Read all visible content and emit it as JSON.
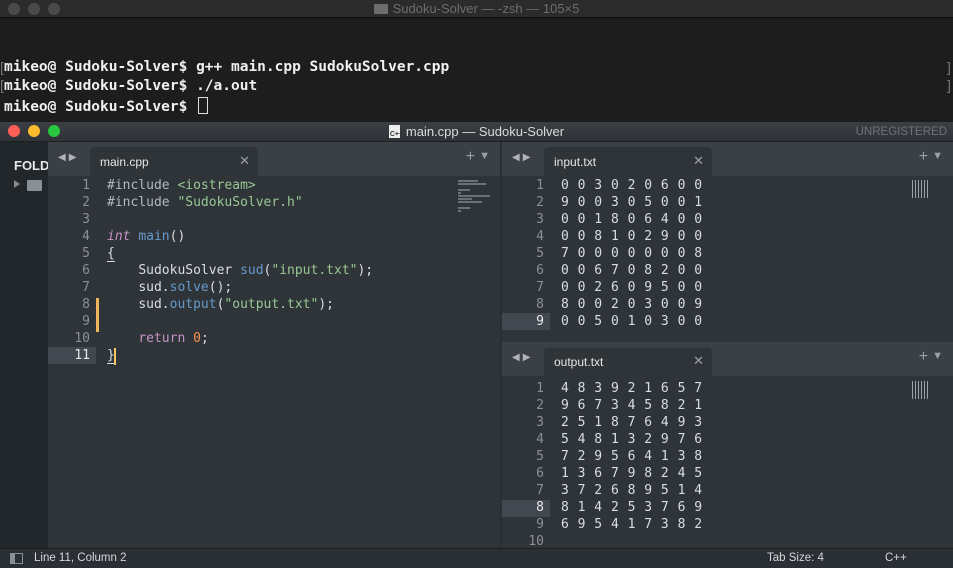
{
  "terminal": {
    "title": "Sudoku-Solver — -zsh — 105×5",
    "lines": [
      {
        "prompt": "mikeo@ Sudoku-Solver$ ",
        "command": "g++ main.cpp SudokuSolver.cpp"
      },
      {
        "prompt": "mikeo@ Sudoku-Solver$ ",
        "command": "./a.out"
      },
      {
        "prompt": "mikeo@ Sudoku-Solver$ ",
        "command": ""
      }
    ]
  },
  "editor": {
    "title": "main.cpp — Sudoku-Solver",
    "unregistered": "UNREGISTERED",
    "sidebar": {
      "folders_label": "FOLD"
    },
    "left_pane": {
      "tab": "main.cpp",
      "current_line": 11,
      "line_numbers": [
        "1",
        "2",
        "3",
        "4",
        "5",
        "6",
        "7",
        "8",
        "9",
        "10",
        "11"
      ]
    },
    "right_top_pane": {
      "tab": "input.txt",
      "current_line": 9,
      "line_numbers": [
        "1",
        "2",
        "3",
        "4",
        "5",
        "6",
        "7",
        "8",
        "9"
      ],
      "lines": [
        "0 0 3 0 2 0 6 0 0",
        "9 0 0 3 0 5 0 0 1",
        "0 0 1 8 0 6 4 0 0",
        "0 0 8 1 0 2 9 0 0",
        "7 0 0 0 0 0 0 0 8",
        "0 0 6 7 0 8 2 0 0",
        "0 0 2 6 0 9 5 0 0",
        "8 0 0 2 0 3 0 0 9",
        "0 0 5 0 1 0 3 0 0"
      ]
    },
    "right_bottom_pane": {
      "tab": "output.txt",
      "current_line": 8,
      "line_numbers": [
        "1",
        "2",
        "3",
        "4",
        "5",
        "6",
        "7",
        "8",
        "9",
        "10"
      ],
      "lines": [
        "4 8 3 9 2 1 6 5 7",
        "9 6 7 3 4 5 8 2 1",
        "2 5 1 8 7 6 4 9 3",
        "5 4 8 1 3 2 9 7 6",
        "7 2 9 5 6 4 1 3 8",
        "1 3 6 7 9 8 2 4 5",
        "3 7 2 6 8 9 5 1 4",
        "8 1 4 2 5 3 7 6 9",
        "6 9 5 4 1 7 3 8 2",
        ""
      ]
    },
    "status": {
      "position": "Line 11, Column 2",
      "tab_size": "Tab Size: 4",
      "syntax": "C++"
    },
    "colors": {
      "close": "#ff5f57",
      "minimize": "#febc2e",
      "zoom": "#28c840",
      "modified_marker": "#f0b25a",
      "caret": "#f6c85f"
    }
  },
  "code": {
    "l1_directive": "#include",
    "l1_header": "<iostream>",
    "l2_directive": "#include",
    "l2_header": "\"SudokuSolver.h\"",
    "l4_type": "int",
    "l4_fn": "main",
    "l4_parens": "()",
    "l5_brace": "{",
    "l6_class": "SudokuSolver",
    "l6_ctor": "sud",
    "l6_arg": "\"input.txt\"",
    "l7_obj": "sud",
    "l7_method": "solve",
    "l8_obj": "sud",
    "l8_method": "output",
    "l8_arg": "\"output.txt\"",
    "l10_kw": "return",
    "l10_val": "0",
    "l11_brace": "}"
  }
}
